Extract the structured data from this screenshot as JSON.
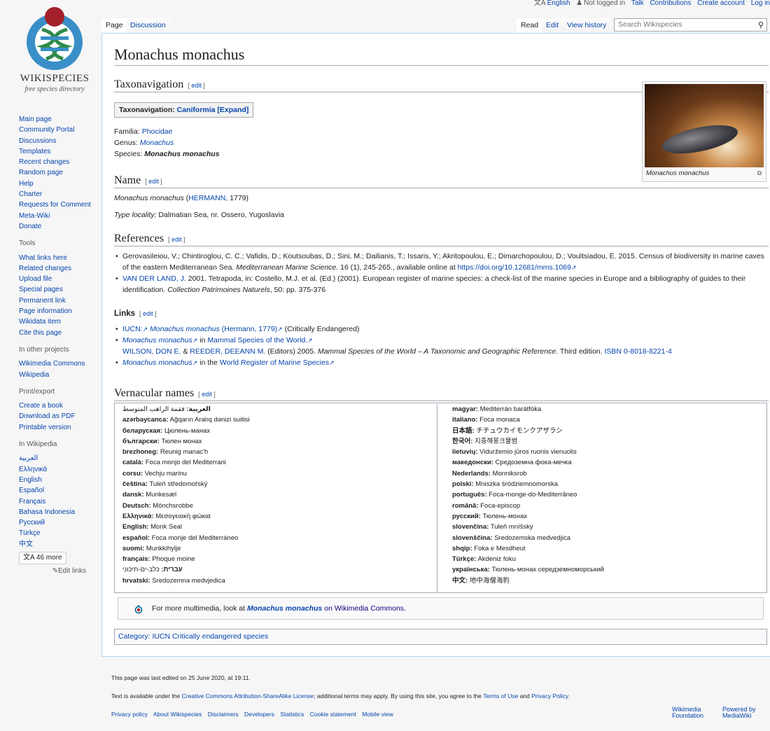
{
  "personal": {
    "language": "English",
    "not_logged_in": "Not logged in",
    "talk": "Talk",
    "contributions": "Contributions",
    "create_account": "Create account",
    "log_in": "Log in"
  },
  "logo": {
    "word": "WIKISPECIES",
    "sub": "free species directory"
  },
  "sidebar": {
    "nav": [
      "Main page",
      "Community Portal",
      "Discussions",
      "Templates",
      "Recent changes",
      "Random page",
      "Help",
      "Charter",
      "Requests for Comment",
      "Meta-Wiki",
      "Donate"
    ],
    "tools_heading": "Tools",
    "tools": [
      "What links here",
      "Related changes",
      "Upload file",
      "Special pages",
      "Permanent link",
      "Page information",
      "Wikidata item",
      "Cite this page"
    ],
    "projects_heading": "In other projects",
    "projects": [
      "Wikimedia Commons",
      "Wikipedia"
    ],
    "print_heading": "Print/export",
    "print": [
      "Create a book",
      "Download as PDF",
      "Printable version"
    ],
    "wikipedia_heading": "In Wikipedia",
    "languages": [
      "العربية",
      "Ελληνικά",
      "English",
      "Español",
      "Français",
      "Bahasa Indonesia",
      "Русский",
      "Türkçe",
      "中文"
    ],
    "more_languages": "46 more",
    "edit_links": "Edit links"
  },
  "tabs": {
    "page": "Page",
    "discussion": "Discussion",
    "read": "Read",
    "edit": "Edit",
    "history": "View history",
    "search_placeholder": "Search Wikispecies"
  },
  "article": {
    "title": "Monachus monachus",
    "edit_label": "edit",
    "taxonav_heading": "Taxonavigation",
    "taxobox": {
      "label": "Taxonavigation:",
      "link": "Caniformia",
      "expand": "[Expand]"
    },
    "familia_label": "Familia:",
    "familia": "Phocidae",
    "genus_label": "Genus:",
    "genus": "Monachus",
    "species_label": "Species:",
    "species": "Monachus monachus",
    "name_heading": "Name",
    "name_taxon": "Monachus monachus",
    "name_author": "HERMANN",
    "name_year": ", 1779)",
    "type_locality_label": "Type locality:",
    "type_locality": "Dalmatian Sea, nr. Ossero, Yugoslavia",
    "image_caption": "Monachus monachus",
    "references_heading": "References",
    "ref1_text": "Gerovasileiou, V.; Chintiroglou, C. C.; Vafidis, D.; Koutsoubas, D.; Sini, M.; Dailianis, T.; Issaris, Y.; Akritopoulou, E.; Dimarchopoulou, D.; Voultsiadou, E. 2015. Census of biodiversity in marine caves of the eastern Mediterranean Sea.",
    "ref1_journal": "Mediterranean Marine Science.",
    "ref1_vol": "16 (1), 245-265., available online at",
    "ref1_doi": "https://doi.org/10.12681/mms.1069",
    "ref2_author": "VAN DER LAND, J.",
    "ref2_text": "2001. Tetrapoda, in: Costello, M.J. et al. (Ed.) (2001). European register of marine species: a check-list of the marine species in Europe and a bibliography of guides to their identification.",
    "ref2_journal": "Collection Patrimoines Naturels",
    "ref2_pages": ", 50: pp. 375-376",
    "links_heading": "Links",
    "link1_prefix": "IUCN:",
    "link1_taxon": "Monachus monachus",
    "link1_author": "(Hermann, 1779)",
    "link1_status": "(Critically Endangered)",
    "link2_taxon": "Monachus monachus",
    "link2_in": "in",
    "link2_source": "Mammal Species of the World.",
    "link2_author1": "WILSON, DON E.",
    "link2_amp": "&",
    "link2_author2": "REEDER, DEEANN M.",
    "link2_editors": "(Editors) 2005.",
    "link2_title": "Mammal Species of the World – A Taxonomic and Geographic Reference.",
    "link2_edition": "Third edition.",
    "link2_isbn": "ISBN 0-8018-8221-4",
    "link3_taxon": "Monachus monachus",
    "link3_in": "in the",
    "link3_source": "World Register of Marine Species",
    "vernacular_heading": "Vernacular names",
    "vernacular_left": [
      {
        "lang": "العربية:",
        "name": "فقمة الراهب المتوسط"
      },
      {
        "lang": "azərbaycanca:",
        "name": "Ağqarın Aralıq dənizi suitisi"
      },
      {
        "lang": "беларуская:",
        "name": "Цюлень-манах"
      },
      {
        "lang": "български:",
        "name": "Тюлен монах"
      },
      {
        "lang": "brezhoneg:",
        "name": "Reunig manac'h"
      },
      {
        "lang": "català:",
        "name": "Foca monjo del Mediterrani"
      },
      {
        "lang": "corsu:",
        "name": "Vechju marinu"
      },
      {
        "lang": "čeština:",
        "name": "Tuleň středomořský"
      },
      {
        "lang": "dansk:",
        "name": "Munkesæl"
      },
      {
        "lang": "Deutsch:",
        "name": "Mönchsrobbe"
      },
      {
        "lang": "Ελληνικά:",
        "name": "Μεσογειακή φώκια"
      },
      {
        "lang": "English:",
        "name": "Monk Seal"
      },
      {
        "lang": "español:",
        "name": "Foca monje del Mediterráneo"
      },
      {
        "lang": "suomi:",
        "name": "Munkkihylje"
      },
      {
        "lang": "français:",
        "name": "Phoque moine"
      },
      {
        "lang": "עברית:",
        "name": "כלב-ים-תיכוני"
      },
      {
        "lang": "hrvatski:",
        "name": "Sredozemna medvjedica"
      }
    ],
    "vernacular_right": [
      {
        "lang": "magyar:",
        "name": "Mediterrán barátfóka"
      },
      {
        "lang": "italiano:",
        "name": "Foca monaca"
      },
      {
        "lang": "日本語:",
        "name": "チチュウカイモンクアザラシ"
      },
      {
        "lang": "한국어:",
        "name": "지중해몽크물범"
      },
      {
        "lang": "lietuvių:",
        "name": "Viduržemio jūros ruonis vienuolis"
      },
      {
        "lang": "македонски:",
        "name": "Средоземна фока-мечка"
      },
      {
        "lang": "Nederlands:",
        "name": "Monniksrob"
      },
      {
        "lang": "polski:",
        "name": "Mniszka śródziemnomorska"
      },
      {
        "lang": "português:",
        "name": "Foca-monge-do-Mediterrâneo"
      },
      {
        "lang": "română:",
        "name": "Foca-episcop"
      },
      {
        "lang": "русский:",
        "name": "Тюлень-монах"
      },
      {
        "lang": "slovenčina:",
        "name": "Tuleň mníšsky"
      },
      {
        "lang": "slovenščina:",
        "name": "Sredozemska medvedjica"
      },
      {
        "lang": "shqip:",
        "name": "Foka e Mesdheut"
      },
      {
        "lang": "Türkçe:",
        "name": "Akdeniz foku"
      },
      {
        "lang": "українська:",
        "name": "Тюлень-монах середземноморський"
      },
      {
        "lang": "中文:",
        "name": "地中海僧海豹"
      }
    ],
    "commons_prefix": "For more multimedia, look at",
    "commons_taxon": "Monachus monachus",
    "commons_suffix": "on Wikimedia Commons.",
    "category_label": "Category:",
    "category": "IUCN Critically endangered species"
  },
  "footer": {
    "last_edited": "This page was last edited on 25 June 2020, at 19:11.",
    "license_prefix": "Text is available under the",
    "license_link": "Creative Commons Attribution-ShareAlike License",
    "license_mid": "; additional terms may apply. By using this site, you agree to the",
    "terms": "Terms of Use",
    "and": "and",
    "privacy_policy": "Privacy Policy.",
    "links": [
      "Privacy policy",
      "About Wikispecies",
      "Disclaimers",
      "Developers",
      "Statistics",
      "Cookie statement",
      "Mobile view"
    ],
    "wikimedia_1": "Wikimedia",
    "wikimedia_2": "Foundation",
    "powered_1": "Powered by",
    "powered_2": "MediaWiki"
  },
  "colors": {
    "link": "#0645ad",
    "visited": "#0b0080",
    "border": "#a7d7f9"
  }
}
